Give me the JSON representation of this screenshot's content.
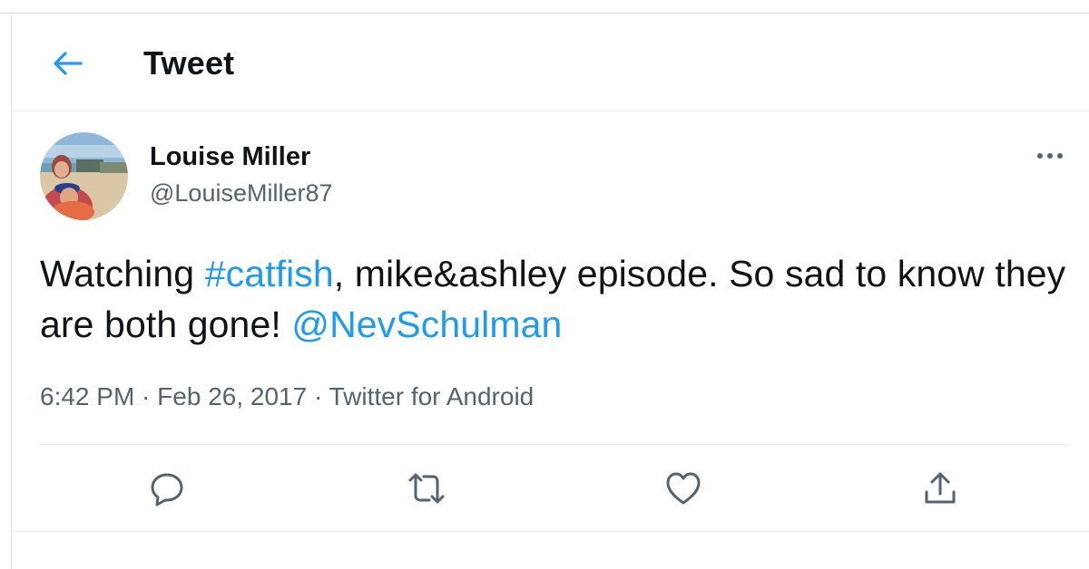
{
  "header": {
    "back_icon": "arrow-left-icon",
    "title": "Tweet"
  },
  "tweet": {
    "author": {
      "display_name": "Louise Miller",
      "handle": "@LouiseMiller87",
      "avatar_description_icon": "avatar-photo"
    },
    "more_icon": "more-horizontal-icon",
    "text_parts": {
      "part1": "Watching ",
      "hashtag": "#catfish",
      "part2": ", mike&ashley episode. So sad to know they are both gone! ",
      "mention": "@NevSchulman"
    },
    "meta": {
      "time": "6:42 PM",
      "separator": " · ",
      "date": "Feb 26, 2017",
      "source": "Twitter for Android"
    },
    "actions": [
      {
        "name": "reply",
        "icon": "reply-bubble-icon"
      },
      {
        "name": "retweet",
        "icon": "retweet-icon"
      },
      {
        "name": "like",
        "icon": "heart-icon"
      },
      {
        "name": "share",
        "icon": "share-upload-icon"
      }
    ]
  },
  "colors": {
    "accent": "#1d9bf0",
    "text_primary": "#0f1419",
    "text_secondary": "#536471",
    "divider": "#e6ecf0"
  }
}
